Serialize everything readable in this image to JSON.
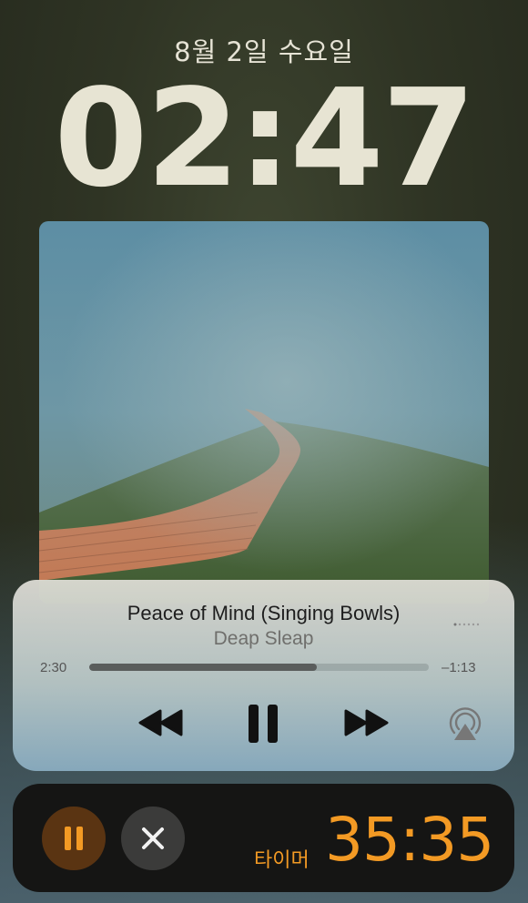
{
  "lock_screen": {
    "date": "8월 2일 수요일",
    "time": "02:47"
  },
  "now_playing": {
    "artwork": "foggy-boardwalk-artwork",
    "title": "Peace of Mind (Singing Bowls)",
    "artist": "Deap Sleap",
    "elapsed": "2:30",
    "remaining": "–1:13",
    "progress_fraction": 0.67,
    "controls": [
      "rewind-icon",
      "pause-icon",
      "fast-forward-icon",
      "airplay-icon"
    ]
  },
  "timer": {
    "label": "타이머",
    "value": "35:35",
    "accent_color": "#f39a24",
    "controls": [
      "pause-icon",
      "close-icon"
    ]
  }
}
